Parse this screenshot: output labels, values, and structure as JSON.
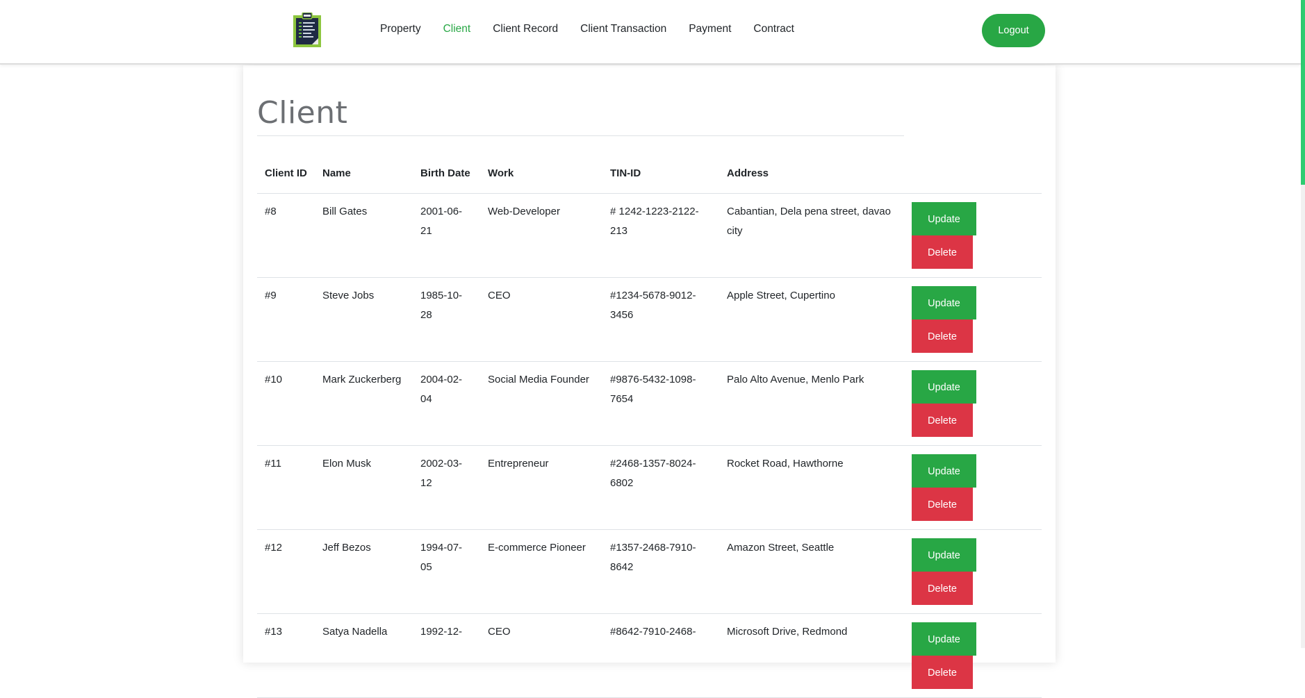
{
  "nav": {
    "logo_icon": "clipboard-icon",
    "links": [
      "Property",
      "Client",
      "Client Record",
      "Client Transaction",
      "Payment",
      "Contract"
    ],
    "active": "Client",
    "logout_label": "Logout"
  },
  "page": {
    "title": "Client"
  },
  "table": {
    "headers": {
      "id": "Client ID",
      "name": "Name",
      "birth": "Birth Date",
      "work": "Work",
      "tin": "TIN-ID",
      "address": "Address"
    },
    "rows": [
      {
        "id": "#8",
        "name": "Bill Gates",
        "birth": "2001-06-21",
        "work": "Web-Developer",
        "tin": "# 1242-1223-2122-213",
        "address": "Cabantian, Dela pena street, davao city"
      },
      {
        "id": "#9",
        "name": "Steve Jobs",
        "birth": "1985-10-28",
        "work": "CEO",
        "tin": "#1234-5678-9012-3456",
        "address": "Apple Street, Cupertino"
      },
      {
        "id": "#10",
        "name": "Mark Zuckerberg",
        "birth": "2004-02-04",
        "work": "Social Media Founder",
        "tin": "#9876-5432-1098-7654",
        "address": "Palo Alto Avenue, Menlo Park"
      },
      {
        "id": "#11",
        "name": "Elon Musk",
        "birth": "2002-03-12",
        "work": "Entrepreneur",
        "tin": "#2468-1357-8024-6802",
        "address": "Rocket Road, Hawthorne"
      },
      {
        "id": "#12",
        "name": "Jeff Bezos",
        "birth": "1994-07-05",
        "work": "E-commerce Pioneer",
        "tin": "#1357-2468-7910-8642",
        "address": "Amazon Street, Seattle"
      },
      {
        "id": "#13",
        "name": "Satya Nadella",
        "birth": "1992-12-",
        "work": "CEO",
        "tin": "#8642-7910-2468-",
        "address": "Microsoft Drive, Redmond"
      }
    ],
    "update_label": "Update",
    "delete_label": "Delete"
  },
  "colors": {
    "accent_green": "#28a745",
    "danger_red": "#dc3545",
    "scrollbar": "#2ecc71"
  }
}
